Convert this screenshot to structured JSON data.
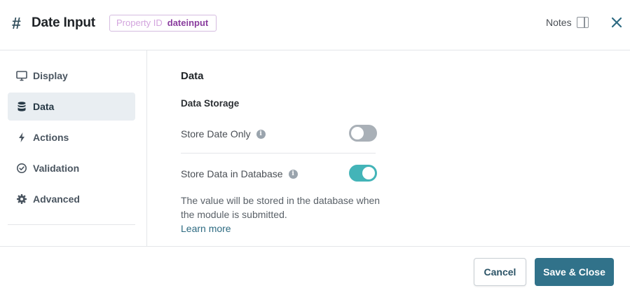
{
  "header": {
    "title": "Date Input",
    "property_id_label": "Property ID",
    "property_id_value": "dateinput",
    "notes_label": "Notes"
  },
  "sidebar": {
    "items": [
      {
        "label": "Display",
        "icon": "monitor-icon",
        "active": false
      },
      {
        "label": "Data",
        "icon": "database-icon",
        "active": true
      },
      {
        "label": "Actions",
        "icon": "lightning-icon",
        "active": false
      },
      {
        "label": "Validation",
        "icon": "check-circle-icon",
        "active": false
      },
      {
        "label": "Advanced",
        "icon": "gear-icon",
        "active": false
      }
    ]
  },
  "main": {
    "section_title": "Data",
    "subsection_title": "Data Storage",
    "settings": [
      {
        "label": "Store Date Only",
        "enabled": false
      },
      {
        "label": "Store Data in Database",
        "enabled": true
      }
    ],
    "help_text": "The value will be stored in the database when the module is submitted.",
    "learn_more": "Learn more"
  },
  "footer": {
    "cancel_label": "Cancel",
    "save_label": "Save & Close"
  },
  "colors": {
    "accent": "#31728a",
    "toggle_on": "#43b4b8",
    "toggle_off": "#a9b0b7",
    "badge_value": "#8a3d9e"
  }
}
